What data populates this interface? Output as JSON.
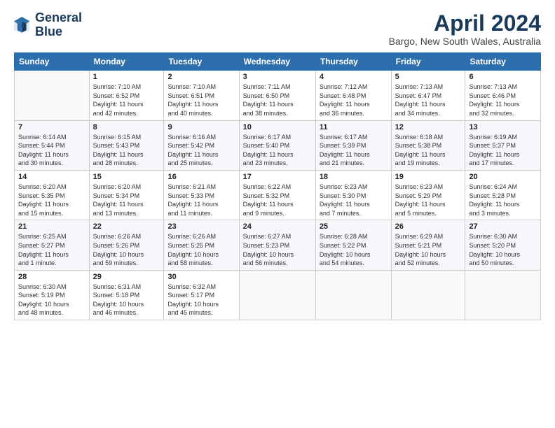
{
  "header": {
    "logo_line1": "General",
    "logo_line2": "Blue",
    "month": "April 2024",
    "location": "Bargo, New South Wales, Australia"
  },
  "weekdays": [
    "Sunday",
    "Monday",
    "Tuesday",
    "Wednesday",
    "Thursday",
    "Friday",
    "Saturday"
  ],
  "weeks": [
    [
      {
        "day": "",
        "info": ""
      },
      {
        "day": "1",
        "info": "Sunrise: 7:10 AM\nSunset: 6:52 PM\nDaylight: 11 hours\nand 42 minutes."
      },
      {
        "day": "2",
        "info": "Sunrise: 7:10 AM\nSunset: 6:51 PM\nDaylight: 11 hours\nand 40 minutes."
      },
      {
        "day": "3",
        "info": "Sunrise: 7:11 AM\nSunset: 6:50 PM\nDaylight: 11 hours\nand 38 minutes."
      },
      {
        "day": "4",
        "info": "Sunrise: 7:12 AM\nSunset: 6:48 PM\nDaylight: 11 hours\nand 36 minutes."
      },
      {
        "day": "5",
        "info": "Sunrise: 7:13 AM\nSunset: 6:47 PM\nDaylight: 11 hours\nand 34 minutes."
      },
      {
        "day": "6",
        "info": "Sunrise: 7:13 AM\nSunset: 6:46 PM\nDaylight: 11 hours\nand 32 minutes."
      }
    ],
    [
      {
        "day": "7",
        "info": "Sunrise: 6:14 AM\nSunset: 5:44 PM\nDaylight: 11 hours\nand 30 minutes."
      },
      {
        "day": "8",
        "info": "Sunrise: 6:15 AM\nSunset: 5:43 PM\nDaylight: 11 hours\nand 28 minutes."
      },
      {
        "day": "9",
        "info": "Sunrise: 6:16 AM\nSunset: 5:42 PM\nDaylight: 11 hours\nand 25 minutes."
      },
      {
        "day": "10",
        "info": "Sunrise: 6:17 AM\nSunset: 5:40 PM\nDaylight: 11 hours\nand 23 minutes."
      },
      {
        "day": "11",
        "info": "Sunrise: 6:17 AM\nSunset: 5:39 PM\nDaylight: 11 hours\nand 21 minutes."
      },
      {
        "day": "12",
        "info": "Sunrise: 6:18 AM\nSunset: 5:38 PM\nDaylight: 11 hours\nand 19 minutes."
      },
      {
        "day": "13",
        "info": "Sunrise: 6:19 AM\nSunset: 5:37 PM\nDaylight: 11 hours\nand 17 minutes."
      }
    ],
    [
      {
        "day": "14",
        "info": "Sunrise: 6:20 AM\nSunset: 5:35 PM\nDaylight: 11 hours\nand 15 minutes."
      },
      {
        "day": "15",
        "info": "Sunrise: 6:20 AM\nSunset: 5:34 PM\nDaylight: 11 hours\nand 13 minutes."
      },
      {
        "day": "16",
        "info": "Sunrise: 6:21 AM\nSunset: 5:33 PM\nDaylight: 11 hours\nand 11 minutes."
      },
      {
        "day": "17",
        "info": "Sunrise: 6:22 AM\nSunset: 5:32 PM\nDaylight: 11 hours\nand 9 minutes."
      },
      {
        "day": "18",
        "info": "Sunrise: 6:23 AM\nSunset: 5:30 PM\nDaylight: 11 hours\nand 7 minutes."
      },
      {
        "day": "19",
        "info": "Sunrise: 6:23 AM\nSunset: 5:29 PM\nDaylight: 11 hours\nand 5 minutes."
      },
      {
        "day": "20",
        "info": "Sunrise: 6:24 AM\nSunset: 5:28 PM\nDaylight: 11 hours\nand 3 minutes."
      }
    ],
    [
      {
        "day": "21",
        "info": "Sunrise: 6:25 AM\nSunset: 5:27 PM\nDaylight: 11 hours\nand 1 minute."
      },
      {
        "day": "22",
        "info": "Sunrise: 6:26 AM\nSunset: 5:26 PM\nDaylight: 10 hours\nand 59 minutes."
      },
      {
        "day": "23",
        "info": "Sunrise: 6:26 AM\nSunset: 5:25 PM\nDaylight: 10 hours\nand 58 minutes."
      },
      {
        "day": "24",
        "info": "Sunrise: 6:27 AM\nSunset: 5:23 PM\nDaylight: 10 hours\nand 56 minutes."
      },
      {
        "day": "25",
        "info": "Sunrise: 6:28 AM\nSunset: 5:22 PM\nDaylight: 10 hours\nand 54 minutes."
      },
      {
        "day": "26",
        "info": "Sunrise: 6:29 AM\nSunset: 5:21 PM\nDaylight: 10 hours\nand 52 minutes."
      },
      {
        "day": "27",
        "info": "Sunrise: 6:30 AM\nSunset: 5:20 PM\nDaylight: 10 hours\nand 50 minutes."
      }
    ],
    [
      {
        "day": "28",
        "info": "Sunrise: 6:30 AM\nSunset: 5:19 PM\nDaylight: 10 hours\nand 48 minutes."
      },
      {
        "day": "29",
        "info": "Sunrise: 6:31 AM\nSunset: 5:18 PM\nDaylight: 10 hours\nand 46 minutes."
      },
      {
        "day": "30",
        "info": "Sunrise: 6:32 AM\nSunset: 5:17 PM\nDaylight: 10 hours\nand 45 minutes."
      },
      {
        "day": "",
        "info": ""
      },
      {
        "day": "",
        "info": ""
      },
      {
        "day": "",
        "info": ""
      },
      {
        "day": "",
        "info": ""
      }
    ]
  ]
}
